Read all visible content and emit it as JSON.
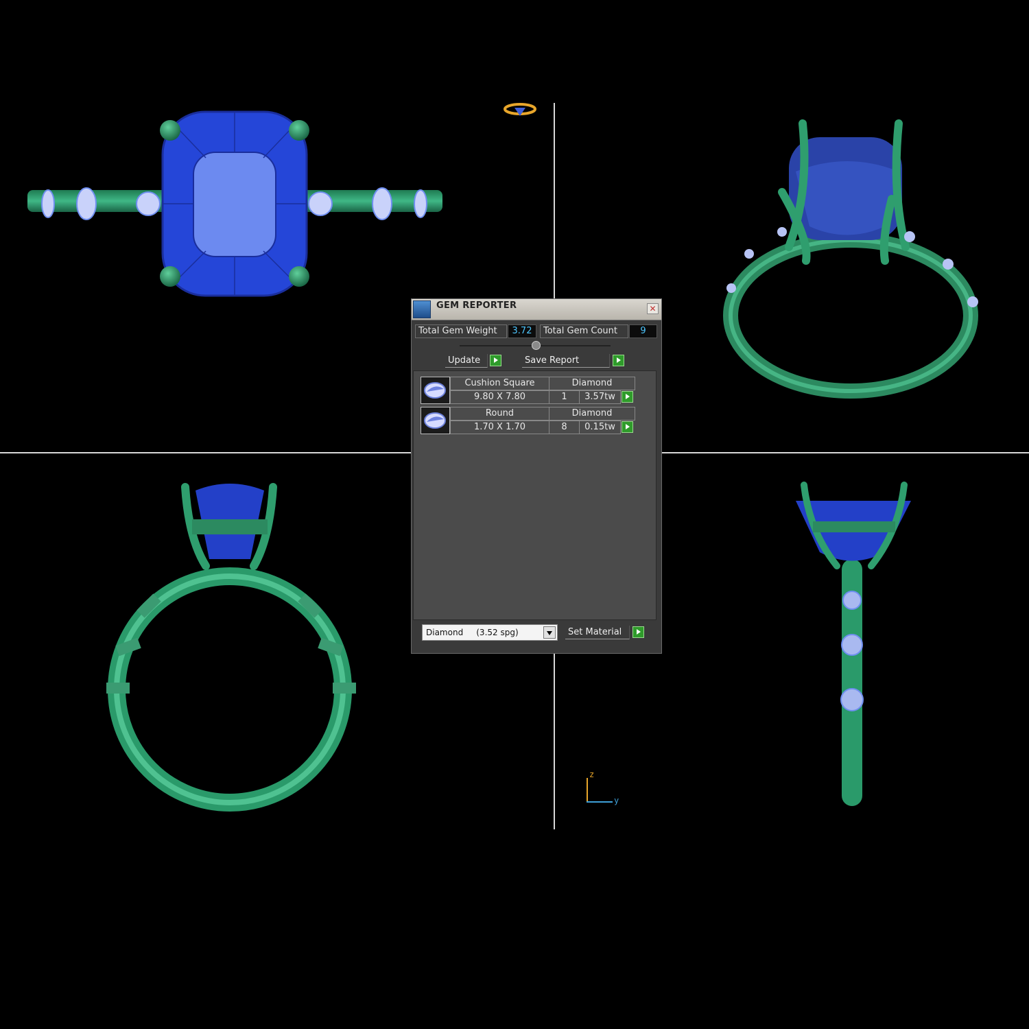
{
  "gem_reporter": {
    "title": "GEM REPORTER",
    "close_icon": "close-icon",
    "total_weight_label": "Total Gem Weight",
    "total_weight_value": "3.72",
    "total_count_label": "Total Gem Count",
    "total_count_value": "9",
    "update_label": "Update",
    "save_report_label": "Save Report",
    "gems": [
      {
        "cut": "Cushion Square",
        "material": "Diamond",
        "size": "9.80 X 7.80",
        "count": "1",
        "weight": "3.57tw"
      },
      {
        "cut": "Round",
        "material": "Diamond",
        "size": "1.70 X 1.70",
        "count": "8",
        "weight": "0.15tw"
      }
    ],
    "material_select_value": "Diamond     (3.52 spg)",
    "set_material_label": "Set Material"
  },
  "axis_indicator": {
    "z_label": "z",
    "y_label": "y"
  },
  "colors": {
    "background": "#000000",
    "metal": "#2f9e6e",
    "center_stone": "#2a4fd6",
    "accent_stone": "#b7c4f5",
    "value_text": "#4ec7ff",
    "go_button": "#2f9b2b"
  }
}
